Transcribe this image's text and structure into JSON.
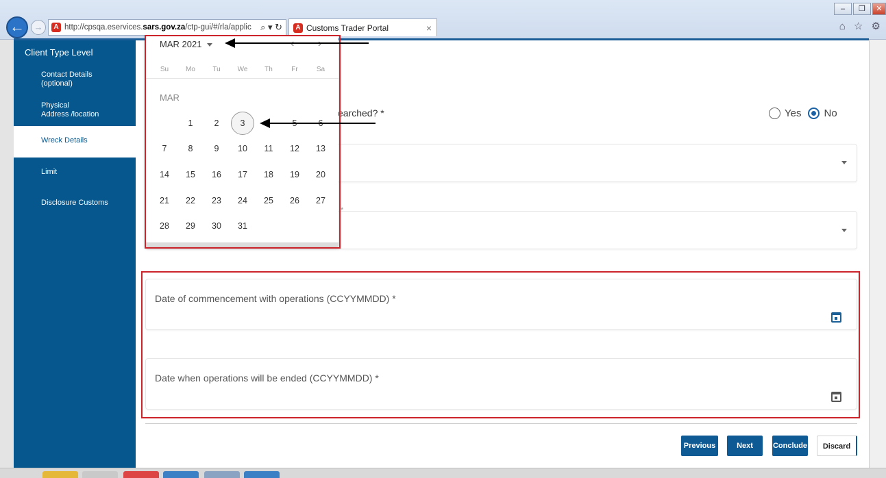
{
  "browser": {
    "url_plain_start": "http://cpsqa.eservices.",
    "url_bold": "sars.gov.za",
    "url_plain_end": "/ctp-gui/#/rla/applic",
    "url_tools": "⌕ ▾ ↻",
    "tab_title": "Customs Trader Portal",
    "tab_close": "×",
    "site_icon": "A",
    "right_icons": "⌂ ☆ ⚙",
    "window_buttons": {
      "minimize": "–",
      "restore": "❒",
      "close": "✕"
    },
    "back": "←",
    "forward": "→"
  },
  "sidebar": {
    "title": "Client Type Level",
    "items": [
      {
        "line1": "Contact Details",
        "line2": "(optional)",
        "active": false
      },
      {
        "line1": "Physical",
        "line2": "Address /location",
        "active": false
      },
      {
        "line1": "Wreck Details",
        "line2": "",
        "active": true
      },
      {
        "line1": "Limit",
        "line2": "",
        "active": false
      },
      {
        "line1": "Disclosure Customs",
        "line2": "",
        "active": false
      }
    ]
  },
  "form": {
    "question_fragment": "earched? *",
    "radio_yes": "Yes",
    "radio_no": "No",
    "selected_radio": "No",
    "stray_asterisk": "*",
    "date_commencement_label": "Date of commencement with operations (CCYYMMDD) *",
    "date_end_label": "Date when operations will be ended (CCYYMMDD) *"
  },
  "buttons": {
    "previous": "Previous",
    "next": "Next",
    "conclude": "Conclude",
    "discard": "Discard"
  },
  "datepicker": {
    "header": "MAR 2021",
    "prev": "‹",
    "next": "›",
    "weekdays": [
      "Su",
      "Mo",
      "Tu",
      "We",
      "Th",
      "Fr",
      "Sa"
    ],
    "month_label": "MAR",
    "first_weekday_index": 1,
    "days_in_month": 31,
    "today": 3,
    "visible_days_row1": [
      "1",
      "2",
      "3",
      "5",
      "6"
    ]
  },
  "colors": {
    "sidebar_bg": "#05578e",
    "primary_button": "#0d5a95",
    "annotation_red": "#cc2229",
    "radio_selected": "#1a62a5"
  }
}
